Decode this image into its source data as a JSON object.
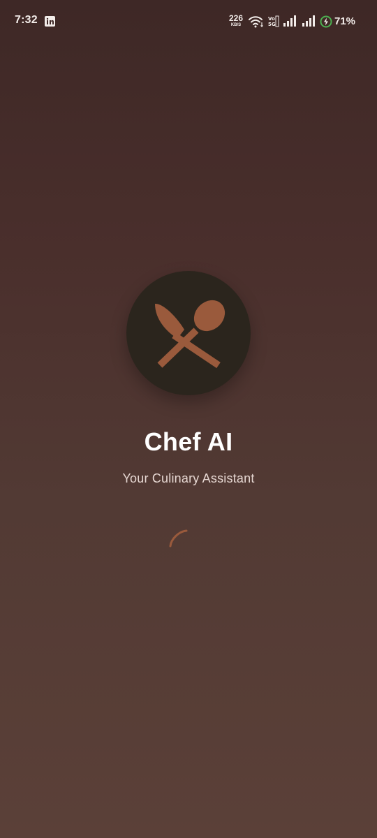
{
  "status_bar": {
    "time": "7:32",
    "notification_icon": "linkedin-icon",
    "network_speed_value": "226",
    "network_speed_unit": "KB/S",
    "battery_percent": "71%",
    "volte_label_top": "Vo",
    "volte_label_bottom": "5G"
  },
  "app": {
    "title": "Chef AI",
    "subtitle": "Your Culinary Assistant",
    "logo_icon": "knife-and-spoon-icon",
    "loading_indicator": "spinner-icon"
  },
  "colors": {
    "background_top": "#3e2826",
    "background_bottom": "#5b4038",
    "logo_circle": "#2b251d",
    "accent": "#9a5a3c",
    "subtitle_text": "#e6d7d2",
    "battery_ring": "#4caf50"
  }
}
